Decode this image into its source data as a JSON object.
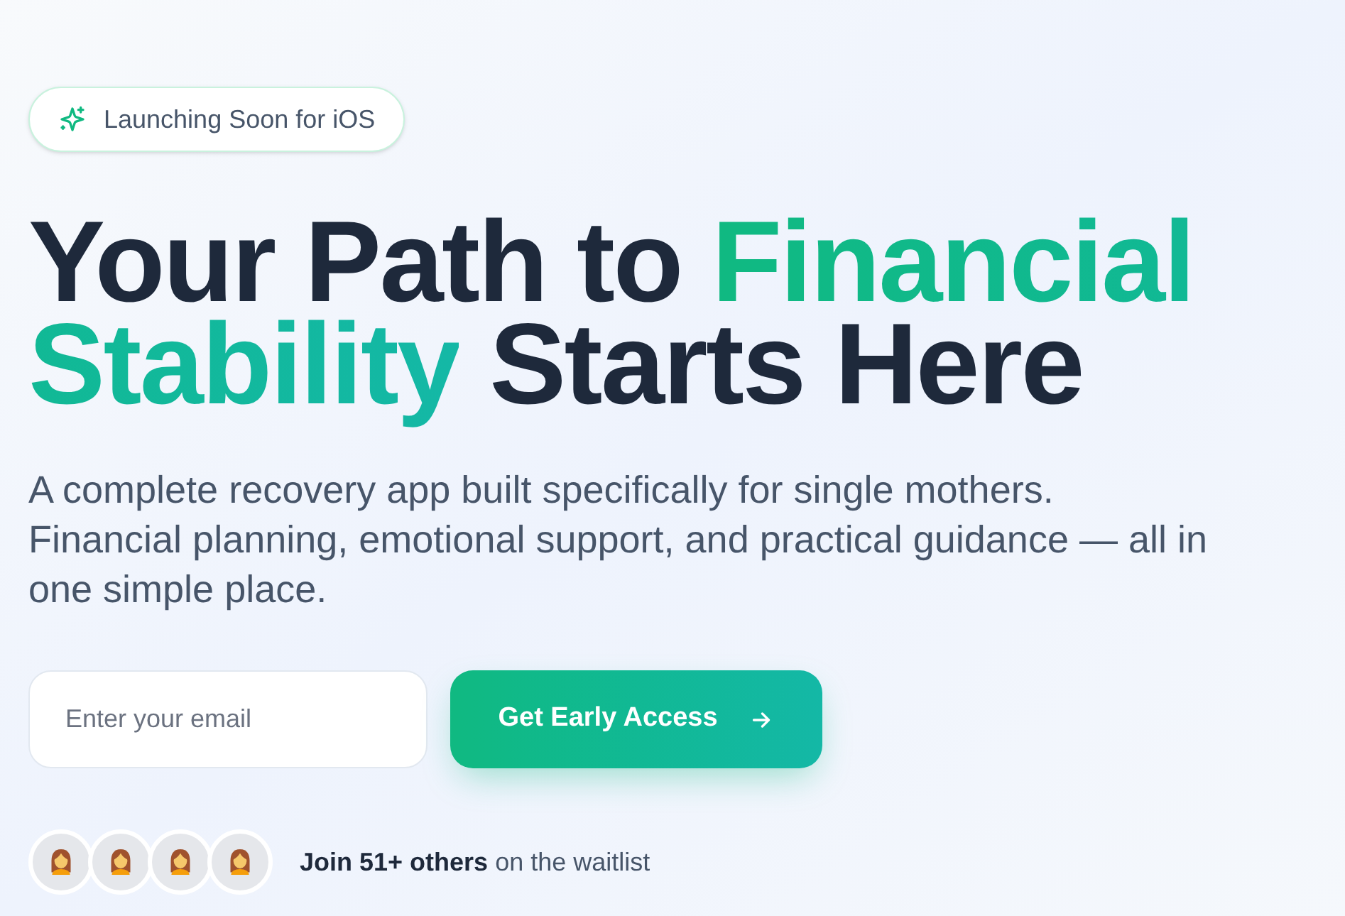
{
  "badge": {
    "label": "Launching Soon for iOS"
  },
  "headline": {
    "parts": [
      {
        "text": "Your Path to ",
        "kind": "plain"
      },
      {
        "text": "Financial Stability",
        "kind": "accent"
      },
      {
        "text": " Starts Here",
        "kind": "plain"
      }
    ]
  },
  "description": {
    "lines": [
      "A complete recovery app built specifically for single mothers.",
      "Financial planning, emotional support, and practical guidance — all in one simple place."
    ]
  },
  "signup": {
    "email_placeholder": "Enter your email",
    "button": "Get Early Access"
  },
  "waitlist": {
    "avatars": [
      {
        "kind": "woman"
      },
      {
        "kind": "woman"
      },
      {
        "kind": "woman"
      },
      {
        "kind": "woman"
      }
    ],
    "text": "**Join 51+ others** on the waitlist"
  }
}
